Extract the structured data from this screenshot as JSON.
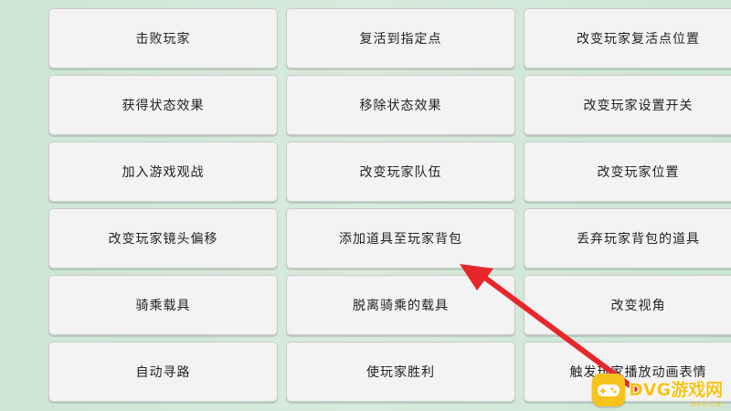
{
  "buttons": [
    {
      "label": "击败玩家"
    },
    {
      "label": "复活到指定点"
    },
    {
      "label": "改变玩家复活点位置"
    },
    {
      "label": "获得状态效果"
    },
    {
      "label": "移除状态效果"
    },
    {
      "label": "改变玩家设置开关"
    },
    {
      "label": "加入游戏观战"
    },
    {
      "label": "改变玩家队伍"
    },
    {
      "label": "改变玩家位置"
    },
    {
      "label": "改变玩家镜头偏移"
    },
    {
      "label": "添加道具至玩家背包"
    },
    {
      "label": "丢弃玩家背包的道具"
    },
    {
      "label": "骑乘载具"
    },
    {
      "label": "脱离骑乘的载具"
    },
    {
      "label": "改变视角"
    },
    {
      "label": "自动寻路"
    },
    {
      "label": "使玩家胜利"
    },
    {
      "label": "触发玩家播放动画表情"
    }
  ],
  "annotation": {
    "arrow_color": "#e8262a",
    "points_to": "添加道具至玩家背包"
  },
  "watermark": {
    "brand": "DVG游戏网",
    "url": "DVG.CN",
    "icon": "gamepad-icon",
    "color": "#f6c21b"
  }
}
